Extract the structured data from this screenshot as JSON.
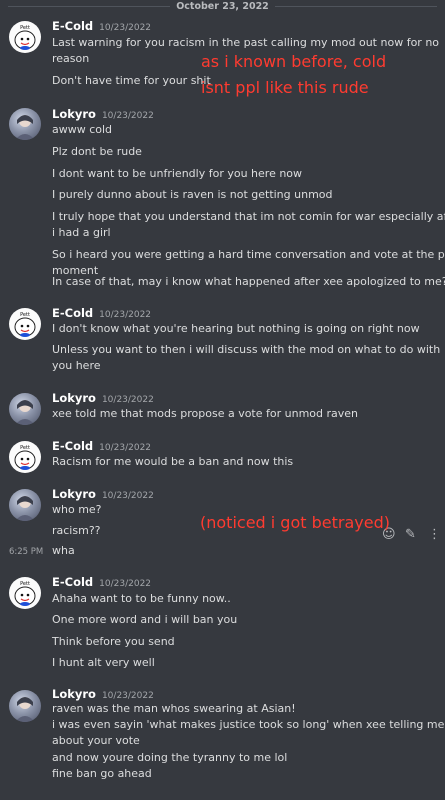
{
  "date_divider": "October 23, 2022",
  "messages": [
    {
      "user": "E-Cold",
      "time": "10/23/2022",
      "avatar": "cartoon-avatar",
      "lines": [
        "Last warning for you racism in the past calling my mod out now for no",
        "reason",
        "Don't have time for your shit"
      ]
    },
    {
      "user": "Lokyro",
      "time": "10/23/2022",
      "avatar": "photo-avatar",
      "lines": [
        "awww cold",
        "Plz dont be rude",
        "I dont want to be unfriendly for you here now",
        "I purely dunno about is raven is not getting unmod",
        "I truly hope that you understand that im not comin for war especially after",
        "i had a girl",
        "So i heard you were getting a hard time conversation and vote at the past",
        "moment",
        "In case of that, may i know what happened after xee apologized to me?"
      ]
    },
    {
      "user": "E-Cold",
      "time": "10/23/2022",
      "avatar": "cartoon-avatar",
      "lines": [
        "I don't know what you're hearing but nothing is going on right now",
        "Unless you want to then i will discuss with the mod on what to do with",
        "you here"
      ]
    },
    {
      "user": "Lokyro",
      "time": "10/23/2022",
      "avatar": "photo-avatar",
      "lines": [
        "xee told me that mods propose a vote for unmod raven"
      ]
    },
    {
      "user": "E-Cold",
      "time": "10/23/2022",
      "avatar": "cartoon-avatar",
      "lines": [
        "Racism for me would be a ban and now this"
      ]
    },
    {
      "user": "Lokyro",
      "time": "10/23/2022",
      "avatar": "photo-avatar",
      "lines": [
        "who me?",
        "racism??",
        "wha"
      ],
      "side_time": "6:25 PM"
    },
    {
      "user": "E-Cold",
      "time": "10/23/2022",
      "avatar": "cartoon-avatar",
      "lines": [
        "Ahaha want to to be funny now..",
        "One more word and i will ban you",
        "Think before you send",
        "I hunt alt very well"
      ]
    },
    {
      "user": "Lokyro",
      "time": "10/23/2022",
      "avatar": "photo-avatar",
      "lines": [
        "raven was the man whos swearing at Asian!",
        "i was even sayin 'what makes justice took so long' when xee telling me",
        "about your vote",
        "and now youre doing the tyranny to me lol",
        "fine ban go ahead"
      ]
    }
  ],
  "annotations": {
    "top_line1": "as i known before, cold",
    "top_line2": "isnt ppl like this rude",
    "middle": "(noticed i got betrayed)",
    "color": "#ff3b30"
  },
  "toolbar_icons": [
    "add-reaction-icon",
    "edit-icon",
    "more-icon"
  ]
}
